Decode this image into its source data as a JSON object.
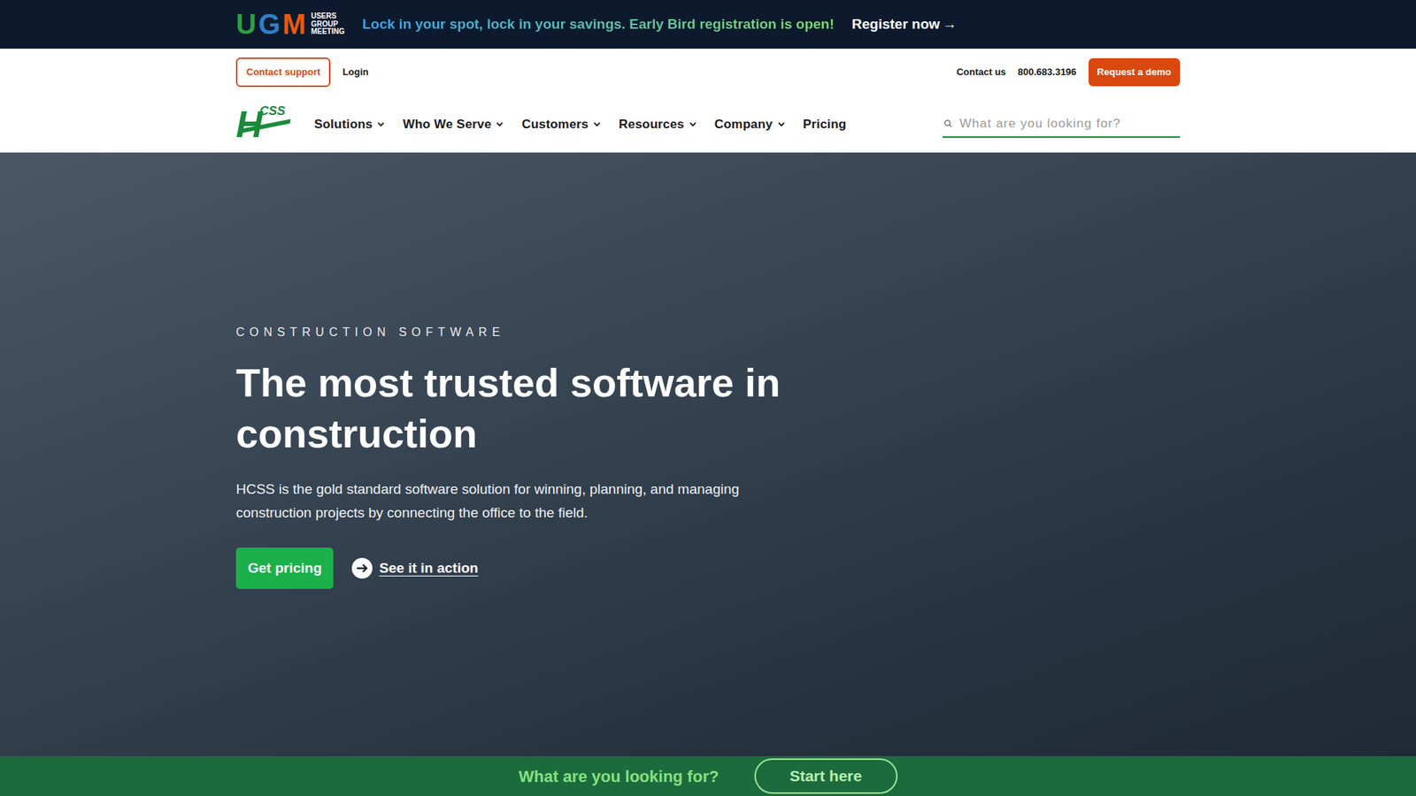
{
  "announcement": {
    "logo_letters": [
      {
        "letter": "U",
        "color": "#2f9e44"
      },
      {
        "letter": "G",
        "color": "#2f80c8"
      },
      {
        "letter": "M",
        "color": "#e8590c"
      }
    ],
    "logo_words": [
      "USERS",
      "GROUP",
      "MEETING"
    ],
    "message": "Lock in your spot, lock in your savings. Early Bird registration is open!",
    "link": "Register now",
    "link_arrow": "→"
  },
  "utility": {
    "support": "Contact support",
    "login": "Login",
    "contact": "Contact us",
    "phone": "800.683.3196",
    "demo": "Request a demo"
  },
  "nav": {
    "logo": {
      "big": "H",
      "small": "CSS"
    },
    "items": [
      {
        "label": "Solutions",
        "dropdown": true
      },
      {
        "label": "Who We Serve",
        "dropdown": true
      },
      {
        "label": "Customers",
        "dropdown": true
      },
      {
        "label": "Resources",
        "dropdown": true
      },
      {
        "label": "Company",
        "dropdown": true
      },
      {
        "label": "Pricing",
        "dropdown": false
      }
    ],
    "search": {
      "placeholder": "What are you looking for?"
    }
  },
  "hero": {
    "eyebrow": "CONSTRUCTION SOFTWARE",
    "title": "The most trusted software in construction",
    "description": "HCSS is the gold standard software solution for winning, planning, and managing construction projects by connecting the office to the field.",
    "primary": "Get pricing",
    "secondary": "See it in action"
  },
  "finder": {
    "prompt": "What are you looking for?",
    "button": "Start here"
  }
}
